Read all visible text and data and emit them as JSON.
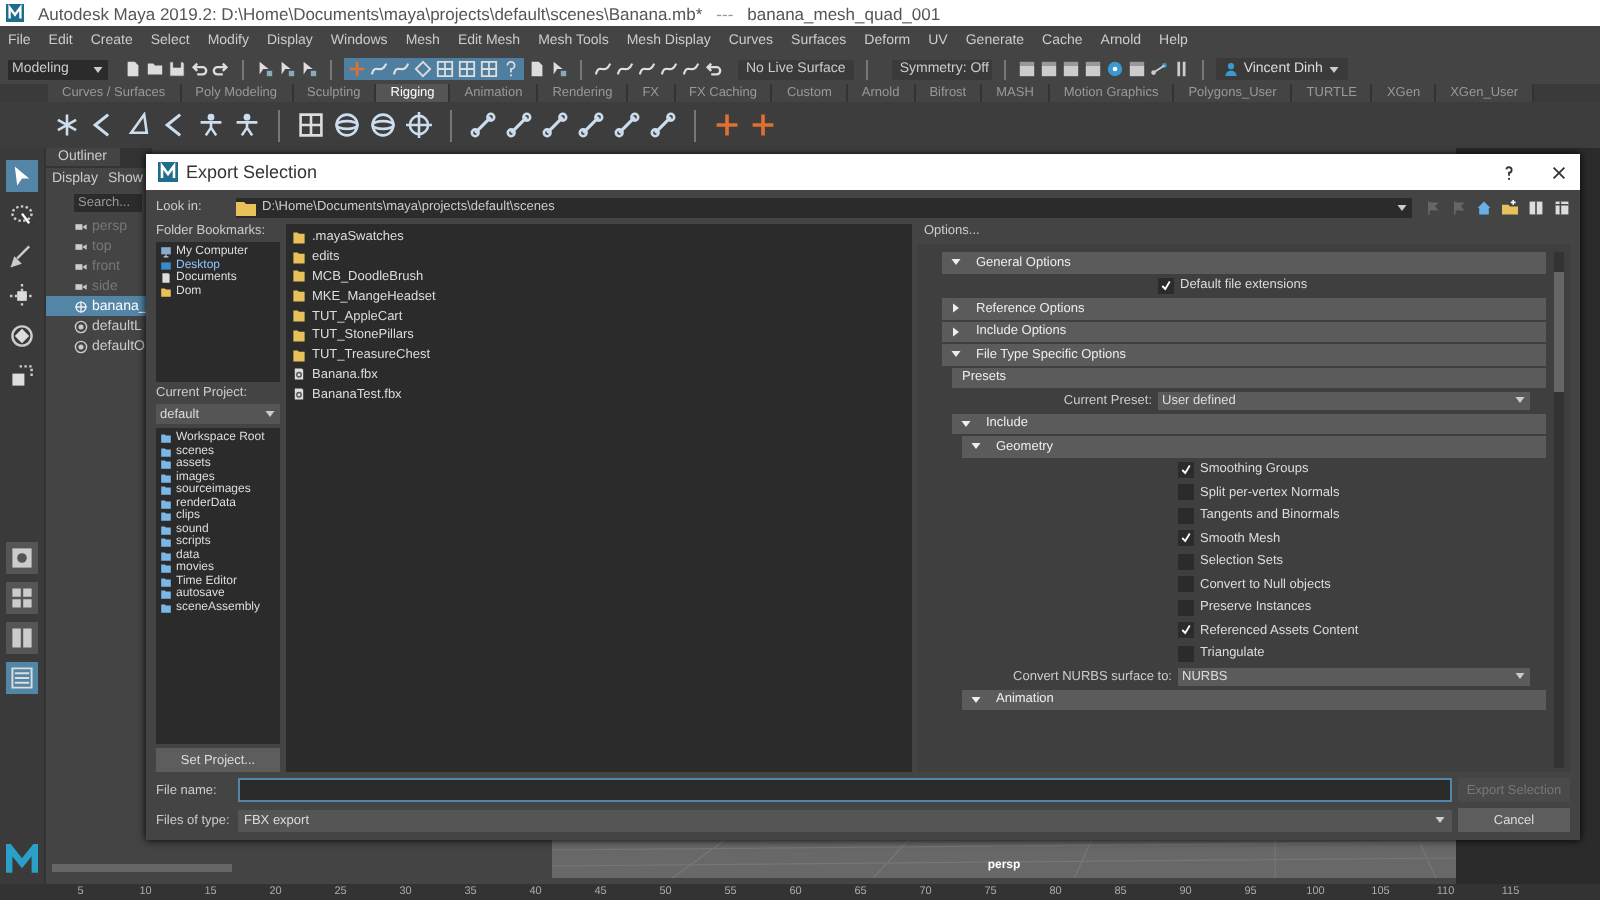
{
  "window": {
    "title": "Autodesk Maya 2019.2: D:\\Home\\Documents\\maya\\projects\\default\\scenes\\Banana.mb*",
    "separator": "---",
    "scene": "banana_mesh_quad_001"
  },
  "menu": [
    "File",
    "Edit",
    "Create",
    "Select",
    "Modify",
    "Display",
    "Windows",
    "Mesh",
    "Edit Mesh",
    "Mesh Tools",
    "Mesh Display",
    "Curves",
    "Surfaces",
    "Deform",
    "UV",
    "Generate",
    "Cache",
    "Arnold",
    "Help"
  ],
  "toolbar": {
    "workspace": "Modeling",
    "live_surface": "No Live Surface",
    "symmetry": "Symmetry: Off",
    "user": "Vincent Dinh"
  },
  "shelf_tabs": [
    {
      "label": "Curves / Surfaces",
      "selected": false
    },
    {
      "label": "Poly Modeling",
      "selected": false
    },
    {
      "label": "Sculpting",
      "selected": false
    },
    {
      "label": "Rigging",
      "selected": true
    },
    {
      "label": "Animation",
      "selected": false
    },
    {
      "label": "Rendering",
      "selected": false
    },
    {
      "label": "FX",
      "selected": false
    },
    {
      "label": "FX Caching",
      "selected": false
    },
    {
      "label": "Custom",
      "selected": false
    },
    {
      "label": "Arnold",
      "selected": false
    },
    {
      "label": "Bifrost",
      "selected": false
    },
    {
      "label": "MASH",
      "selected": false
    },
    {
      "label": "Motion Graphics",
      "selected": false
    },
    {
      "label": "Polygons_User",
      "selected": false
    },
    {
      "label": "TURTLE",
      "selected": false
    },
    {
      "label": "XGen",
      "selected": false
    },
    {
      "label": "XGen_User",
      "selected": false
    }
  ],
  "outliner": {
    "title": "Outliner",
    "menus": [
      "Display",
      "Show"
    ],
    "search_placeholder": "Search...",
    "items": [
      {
        "label": "persp",
        "kind": "camera",
        "selected": false
      },
      {
        "label": "top",
        "kind": "camera",
        "selected": false
      },
      {
        "label": "front",
        "kind": "camera",
        "selected": false
      },
      {
        "label": "side",
        "kind": "camera",
        "selected": false
      },
      {
        "label": "banana_",
        "kind": "mesh",
        "selected": true
      },
      {
        "label": "defaultL",
        "kind": "set",
        "selected": false
      },
      {
        "label": "defaultO",
        "kind": "set",
        "selected": false
      }
    ]
  },
  "dialog": {
    "title": "Export Selection",
    "look_in_label": "Look in:",
    "path": "D:\\Home\\Documents\\maya\\projects\\default\\scenes",
    "bookmarks_label": "Folder Bookmarks:",
    "bookmarks": [
      {
        "label": "My Computer",
        "kind": "computer"
      },
      {
        "label": "Desktop",
        "kind": "desktop"
      },
      {
        "label": "Documents",
        "kind": "document"
      },
      {
        "label": "Dom",
        "kind": "folder"
      }
    ],
    "project_label": "Current Project:",
    "project": "default",
    "project_folders": [
      "Workspace Root",
      "scenes",
      "assets",
      "images",
      "sourceimages",
      "renderData",
      "clips",
      "sound",
      "scripts",
      "data",
      "movies",
      "Time Editor",
      "autosave",
      "sceneAssembly"
    ],
    "set_project": "Set Project...",
    "files": [
      {
        "name": ".mayaSwatches",
        "kind": "folder"
      },
      {
        "name": "edits",
        "kind": "folder"
      },
      {
        "name": "MCB_DoodleBrush",
        "kind": "folder"
      },
      {
        "name": "MKE_MangeHeadset",
        "kind": "folder"
      },
      {
        "name": "TUT_AppleCart",
        "kind": "folder"
      },
      {
        "name": "TUT_StonePillars",
        "kind": "folder"
      },
      {
        "name": "TUT_TreasureChest",
        "kind": "folder"
      },
      {
        "name": "Banana.fbx",
        "kind": "file"
      },
      {
        "name": "BananaTest.fbx",
        "kind": "file"
      }
    ],
    "options_label": "Options...",
    "options": [
      {
        "kind": "section",
        "label": "General Options",
        "expanded": true,
        "children": [
          {
            "kind": "checkbox",
            "label": "Default file extensions",
            "checked": true
          }
        ]
      },
      {
        "kind": "section",
        "label": "Reference Options",
        "expanded": false
      },
      {
        "kind": "section",
        "label": "Include Options",
        "expanded": false
      },
      {
        "kind": "section",
        "label": "File Type Specific Options",
        "expanded": true,
        "children": [
          {
            "kind": "group",
            "label": "Presets"
          },
          {
            "kind": "dropdown",
            "label": "Current Preset:",
            "value": "User defined"
          },
          {
            "kind": "section",
            "label": "Include",
            "expanded": true,
            "children": [
              {
                "kind": "section",
                "label": "Geometry",
                "expanded": true,
                "children": [
                  {
                    "kind": "checkbox",
                    "label": "Smoothing Groups",
                    "checked": true
                  },
                  {
                    "kind": "checkbox",
                    "label": "Split per-vertex Normals",
                    "checked": false
                  },
                  {
                    "kind": "checkbox",
                    "label": "Tangents and Binormals",
                    "checked": false
                  },
                  {
                    "kind": "checkbox",
                    "label": "Smooth Mesh",
                    "checked": true
                  },
                  {
                    "kind": "checkbox",
                    "label": "Selection Sets",
                    "checked": false
                  },
                  {
                    "kind": "checkbox",
                    "label": "Convert to Null objects",
                    "checked": false
                  },
                  {
                    "kind": "checkbox",
                    "label": "Preserve Instances",
                    "checked": false
                  },
                  {
                    "kind": "checkbox",
                    "label": "Referenced Assets Content",
                    "checked": true
                  },
                  {
                    "kind": "checkbox",
                    "label": "Triangulate",
                    "checked": false
                  },
                  {
                    "kind": "dropdown",
                    "label": "Convert NURBS surface to:",
                    "value": "NURBS"
                  }
                ]
              },
              {
                "kind": "section",
                "label": "Animation",
                "expanded": true
              }
            ]
          }
        ]
      }
    ],
    "file_name_label": "File name:",
    "export_button": {
      "label": "Export Selection",
      "disabled": true
    },
    "file_type_label": "Files of type:",
    "file_type": "FBX export",
    "cancel": "Cancel"
  },
  "viewport": {
    "camera": "persp"
  },
  "timeline": [
    "5",
    "10",
    "15",
    "20",
    "25",
    "30",
    "35",
    "40",
    "45",
    "50",
    "55",
    "60",
    "65",
    "70",
    "75",
    "80",
    "85",
    "90",
    "95",
    "100",
    "105",
    "110",
    "115"
  ]
}
